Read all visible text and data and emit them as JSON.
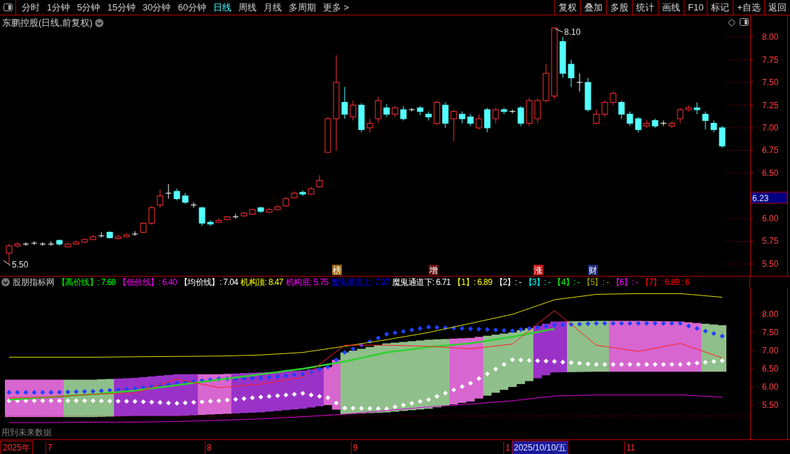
{
  "toolbar": {
    "periods": [
      {
        "label": "分时",
        "selected": false
      },
      {
        "label": "1分钟",
        "selected": false
      },
      {
        "label": "5分钟",
        "selected": false
      },
      {
        "label": "15分钟",
        "selected": false
      },
      {
        "label": "30分钟",
        "selected": false
      },
      {
        "label": "60分钟",
        "selected": false
      },
      {
        "label": "日线",
        "selected": true
      },
      {
        "label": "周线",
        "selected": false
      },
      {
        "label": "月线",
        "selected": false
      },
      {
        "label": "多周期",
        "selected": false
      },
      {
        "label": "更多 >",
        "selected": false
      }
    ],
    "buttons": [
      "复权",
      "叠加",
      "多股",
      "统计",
      "画线",
      "F10",
      "标记",
      "+自选",
      "返回"
    ]
  },
  "price_chart": {
    "title": "东鹏控股(日线,前复权)",
    "current_price": "6.23",
    "high_label": "8.10",
    "low_label": "5.50",
    "markers": [
      {
        "text": "榜",
        "color": "#a06a10"
      },
      {
        "text": "增",
        "color": "#6a1010"
      },
      {
        "text": "涨",
        "color": "#c01818"
      },
      {
        "text": "财",
        "color": "#1c2a78"
      }
    ],
    "chart_data": {
      "type": "candlestick",
      "ylim": [
        5.3615,
        8.2385
      ],
      "yticks": [
        {
          "value": 5.5,
          "label": "5.50"
        },
        {
          "value": 5.75,
          "label": "5.75"
        },
        {
          "value": 6,
          "label": "6.00"
        },
        {
          "value": 6.5,
          "label": "6.50"
        },
        {
          "value": 6.75,
          "label": "6.75"
        },
        {
          "value": 7,
          "label": "7.00"
        },
        {
          "value": 7.25,
          "label": "7.25"
        },
        {
          "value": 7.5,
          "label": "7.50"
        },
        {
          "value": 7.75,
          "label": "7.75"
        },
        {
          "value": 8,
          "label": "8.00"
        }
      ],
      "ohlc": [
        [
          5.62,
          5.72,
          5.5,
          5.7
        ],
        [
          5.7,
          5.74,
          5.68,
          5.72
        ],
        [
          5.72,
          5.74,
          5.7,
          5.72
        ],
        [
          5.73,
          5.75,
          5.71,
          5.73
        ],
        [
          5.72,
          5.74,
          5.7,
          5.72
        ],
        [
          5.72,
          5.75,
          5.7,
          5.72
        ],
        [
          5.76,
          5.77,
          5.7,
          5.72
        ],
        [
          5.69,
          5.73,
          5.68,
          5.72
        ],
        [
          5.72,
          5.76,
          5.71,
          5.74
        ],
        [
          5.74,
          5.78,
          5.73,
          5.77
        ],
        [
          5.77,
          5.82,
          5.76,
          5.8
        ],
        [
          5.81,
          5.85,
          5.79,
          5.81
        ],
        [
          5.85,
          5.86,
          5.78,
          5.79
        ],
        [
          5.78,
          5.82,
          5.77,
          5.8
        ],
        [
          5.8,
          5.84,
          5.79,
          5.82
        ],
        [
          5.83,
          5.86,
          5.81,
          5.83
        ],
        [
          5.85,
          5.96,
          5.84,
          5.95
        ],
        [
          5.95,
          6.14,
          5.93,
          6.12
        ],
        [
          6.15,
          6.32,
          6.12,
          6.25
        ],
        [
          6.28,
          6.38,
          6.22,
          6.28
        ],
        [
          6.3,
          6.33,
          6.2,
          6.22
        ],
        [
          6.25,
          6.28,
          6.16,
          6.18
        ],
        [
          6.15,
          6.18,
          6.12,
          6.15
        ],
        [
          6.12,
          6.13,
          5.92,
          5.95
        ],
        [
          5.96,
          5.98,
          5.92,
          5.94
        ],
        [
          5.96,
          6.0,
          5.95,
          5.98
        ],
        [
          5.99,
          6.03,
          5.98,
          6.02
        ],
        [
          6.02,
          6.05,
          6.0,
          6.02
        ],
        [
          6.03,
          6.07,
          6.02,
          6.06
        ],
        [
          6.05,
          6.11,
          6.04,
          6.1
        ],
        [
          6.12,
          6.13,
          6.06,
          6.08
        ],
        [
          6.07,
          6.12,
          6.06,
          6.1
        ],
        [
          6.1,
          6.15,
          6.09,
          6.13
        ],
        [
          6.14,
          6.24,
          6.13,
          6.22
        ],
        [
          6.23,
          6.3,
          6.22,
          6.28
        ],
        [
          6.29,
          6.31,
          6.25,
          6.27
        ],
        [
          6.27,
          6.35,
          6.26,
          6.33
        ],
        [
          6.35,
          6.48,
          6.34,
          6.42
        ],
        [
          6.73,
          7.12,
          6.73,
          7.1
        ],
        [
          7.1,
          7.8,
          6.75,
          7.5
        ],
        [
          7.28,
          7.45,
          7.1,
          7.15
        ],
        [
          7.12,
          7.3,
          7.08,
          7.25
        ],
        [
          7.25,
          7.27,
          6.95,
          6.98
        ],
        [
          7.0,
          7.1,
          6.95,
          7.05
        ],
        [
          7.1,
          7.34,
          7.05,
          7.3
        ],
        [
          7.22,
          7.26,
          7.12,
          7.15
        ],
        [
          7.15,
          7.24,
          7.12,
          7.22
        ],
        [
          7.2,
          7.24,
          7.08,
          7.1
        ],
        [
          7.2,
          7.22,
          7.18,
          7.2
        ],
        [
          7.22,
          7.24,
          7.14,
          7.18
        ],
        [
          7.15,
          7.18,
          7.08,
          7.12
        ],
        [
          7.05,
          7.3,
          7.03,
          7.28
        ],
        [
          7.25,
          7.28,
          7.0,
          7.05
        ],
        [
          7.1,
          7.2,
          6.85,
          7.18
        ],
        [
          7.15,
          7.18,
          7.05,
          7.1
        ],
        [
          7.12,
          7.15,
          7.02,
          7.05
        ],
        [
          7.0,
          7.15,
          6.98,
          7.1
        ],
        [
          7.2,
          7.22,
          6.95,
          7.0
        ],
        [
          7.1,
          7.22,
          7.05,
          7.2
        ],
        [
          7.2,
          7.22,
          7.15,
          7.18
        ],
        [
          7.18,
          7.2,
          7.16,
          7.18
        ],
        [
          7.22,
          7.24,
          7.02,
          7.05
        ],
        [
          7.05,
          7.33,
          7.02,
          7.3
        ],
        [
          7.1,
          7.32,
          7.05,
          7.3
        ],
        [
          7.3,
          7.7,
          7.28,
          7.6
        ],
        [
          7.35,
          8.1,
          7.32,
          8.1
        ],
        [
          7.95,
          8.0,
          7.55,
          7.6
        ],
        [
          7.7,
          7.75,
          7.45,
          7.55
        ],
        [
          7.5,
          7.6,
          7.4,
          7.5
        ],
        [
          7.5,
          7.55,
          7.18,
          7.2
        ],
        [
          7.05,
          7.2,
          7.05,
          7.15
        ],
        [
          7.15,
          7.3,
          7.12,
          7.28
        ],
        [
          7.28,
          7.4,
          7.25,
          7.38
        ],
        [
          7.28,
          7.3,
          7.1,
          7.15
        ],
        [
          7.15,
          7.18,
          7.02,
          7.05
        ],
        [
          7.1,
          7.12,
          6.95,
          6.98
        ],
        [
          7.02,
          7.08,
          7.0,
          7.05
        ],
        [
          7.08,
          7.1,
          7.0,
          7.02
        ],
        [
          7.05,
          7.08,
          7.02,
          7.05
        ],
        [
          7.02,
          7.07,
          7.0,
          7.05
        ],
        [
          7.1,
          7.22,
          7.05,
          7.2
        ],
        [
          7.2,
          7.25,
          7.18,
          7.22
        ],
        [
          7.22,
          7.28,
          7.15,
          7.2
        ],
        [
          7.15,
          7.18,
          6.98,
          7.08
        ],
        [
          7.05,
          7.08,
          6.95,
          6.98
        ],
        [
          7.0,
          7.02,
          6.78,
          6.8
        ]
      ]
    }
  },
  "indicator": {
    "name": "股朋指标网",
    "legend": [
      {
        "text": "【高价线】: 7.68",
        "color": "#00ff00"
      },
      {
        "text": "【低价线】: 6.40",
        "color": "#ff00ff"
      },
      {
        "text": "【均价线】: 7.04",
        "color": "#ffffff"
      },
      {
        "text": "机构顶: 8.47",
        "color": "#ffff00"
      },
      {
        "text": "机构底: 5.75",
        "color": "#ff00ff"
      },
      {
        "text": "魔鬼通道上: 7.37",
        "color": "#0000ff"
      },
      {
        "text": "魔鬼通道下: 6.71",
        "color": "#ffffff"
      },
      {
        "text": "【1】: 6.89",
        "color": "#ffff00"
      },
      {
        "text": "【2】: -",
        "color": "#ffffff"
      },
      {
        "text": "【3】: -",
        "color": "#00ffff"
      },
      {
        "text": "【4】: -",
        "color": "#00ff00"
      },
      {
        "text": "【5】: -",
        "color": "#a0a000"
      },
      {
        "text": "【6】: -",
        "color": "#ff00ff"
      },
      {
        "text": "【7】: 6.89 : 6",
        "color": "#ff0000"
      }
    ],
    "note": "用到未来数据",
    "chart_data": {
      "type": "line",
      "ylim": [
        4.5577,
        8.7308
      ],
      "yticks": [
        {
          "value": 5.5,
          "label": "5.50"
        },
        {
          "value": 6,
          "label": "6.00"
        },
        {
          "value": 6.5,
          "label": "6.50"
        },
        {
          "value": 7,
          "label": "7.00"
        },
        {
          "value": 7.5,
          "label": "7.50"
        },
        {
          "value": 8,
          "label": "8.00"
        }
      ],
      "series": [
        {
          "color": "#e0e000",
          "values": [
            6.82,
            6.82,
            6.82,
            6.83,
            6.84,
            6.85,
            6.88,
            6.95,
            7.12,
            7.3,
            7.5,
            7.75,
            8.0,
            8.4,
            8.55,
            8.57,
            8.57,
            8.47
          ]
        },
        {
          "color": "#e000e0",
          "values": [
            5.02,
            5.02,
            5.03,
            5.03,
            5.05,
            5.08,
            5.12,
            5.18,
            5.25,
            5.35,
            5.45,
            5.53,
            5.62,
            5.75,
            5.78,
            5.78,
            5.78,
            5.72
          ]
        },
        {
          "color": "#30d030",
          "values": [
            5.65,
            5.72,
            5.8,
            5.9,
            6.05,
            6.2,
            6.35,
            6.5,
            6.7,
            6.95,
            7.1,
            7.2,
            7.38,
            7.6,
            null,
            null,
            null,
            null
          ]
        },
        {
          "color": "#ff2020",
          "values": [
            5.7,
            5.72,
            5.8,
            5.83,
            6.22,
            5.98,
            6.08,
            6.27,
            7.15,
            7.15,
            7.12,
            7.05,
            7.18,
            8.1,
            7.15,
            6.98,
            7.2,
            6.8
          ]
        }
      ]
    }
  },
  "time_axis": {
    "year": "2025年",
    "months": [
      "7",
      "8",
      "9",
      "1",
      "11"
    ],
    "cursor_date": "2025/10/10/五"
  }
}
